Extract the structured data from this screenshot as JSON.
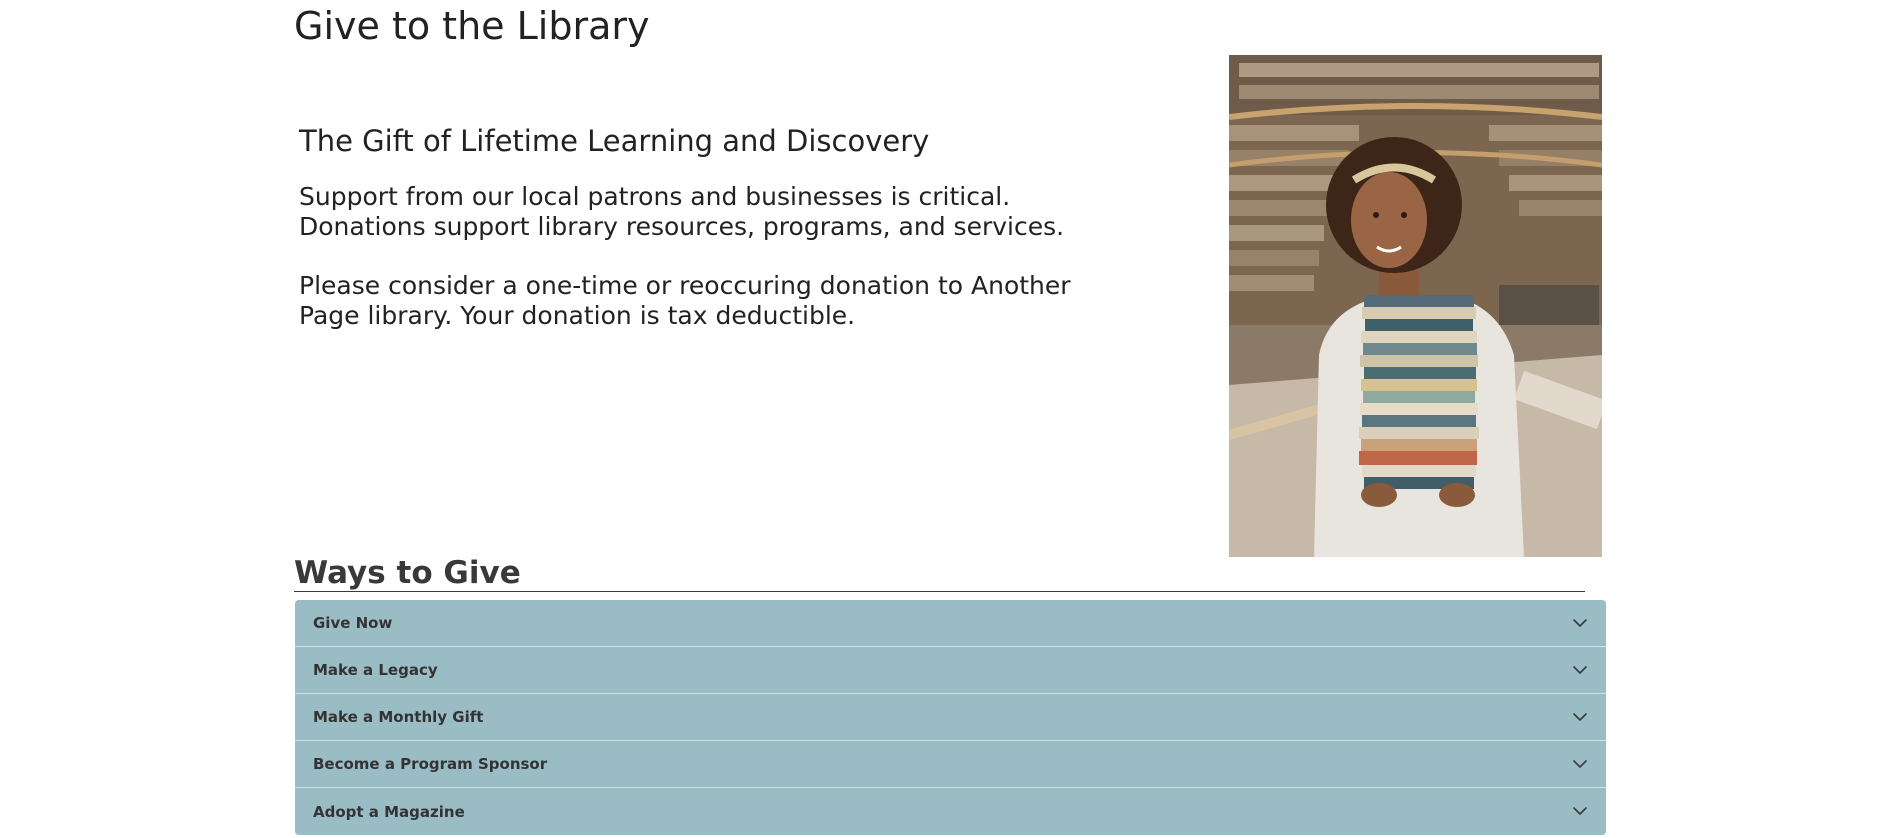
{
  "page": {
    "title": "Give to the Library"
  },
  "intro": {
    "heading": "The Gift of Lifetime Learning and Discovery",
    "paragraph_1_line_1": "Support from our local patrons and businesses is critical.",
    "paragraph_1_line_2": "Donations support library resources, programs, and services.",
    "paragraph_2_line_1": "Please consider a one-time or reoccuring donation to Another",
    "paragraph_2_line_2": "Page library. Your donation is tax deductible."
  },
  "photo": {
    "semantic": "student-holding-stack-of-books-in-library-photo"
  },
  "ways_to_give": {
    "heading": "Ways to Give",
    "items": [
      {
        "label": "Give Now",
        "icon": "chevron-down-icon"
      },
      {
        "label": "Make a Legacy",
        "icon": "chevron-down-icon"
      },
      {
        "label": "Make a Monthly Gift",
        "icon": "chevron-down-icon"
      },
      {
        "label": "Become a Program Sponsor",
        "icon": "chevron-down-icon"
      },
      {
        "label": "Adopt a Magazine",
        "icon": "chevron-down-icon"
      }
    ]
  },
  "colors": {
    "accordion_bg": "#9abcc5",
    "accordion_divider": "#cfe0e4",
    "heading_text": "#3a3838"
  }
}
